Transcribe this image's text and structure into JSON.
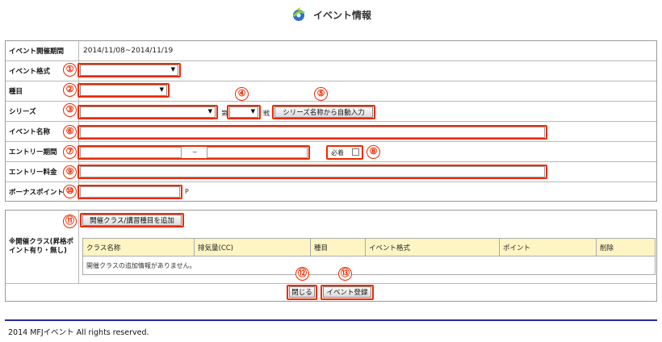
{
  "page": {
    "title": "イベント情報",
    "footer": "2014 MFJイベント All rights reserved."
  },
  "form": {
    "period_label": "イベント開催期間",
    "period_value": "2014/11/08~2014/11/19",
    "format_label": "イベント格式",
    "category_label": "種目",
    "series_label": "シリーズ",
    "series_round_prefix": "第",
    "series_round_suffix": "戦",
    "series_auto_button": "シリーズ名称から自動入力",
    "event_name_label": "イベント名称",
    "entry_period_label": "エントリー期間",
    "entry_period_sep": "~",
    "required_label": "必着",
    "entry_fee_label": "エントリー料金",
    "bonus_point_label": "ボーナスポイント",
    "bonus_point_unit": "P"
  },
  "classes": {
    "label": "※開催クラス(昇格ポイント有り・無し)",
    "add_button": "開催クラス/講習種目を追加",
    "columns": [
      "クラス名称",
      "排気量(CC)",
      "種目",
      "イベント格式",
      "ポイント",
      "削除"
    ],
    "empty_message": "開催クラスの追加情報がありません。"
  },
  "actions": {
    "close_button": "閉じる",
    "register_button": "イベント登録"
  },
  "markers": [
    "①",
    "②",
    "③",
    "④",
    "⑤",
    "⑥",
    "⑦",
    "⑧",
    "⑨",
    "⑩",
    "⑪",
    "⑫",
    "⑬"
  ],
  "colors": {
    "highlight": "#ee2a00",
    "header_bg": "#fff5c4",
    "footer_rule": "#2a2aa0"
  }
}
